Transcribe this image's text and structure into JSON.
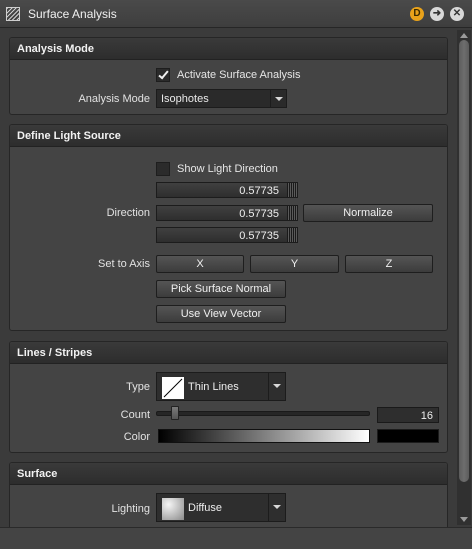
{
  "window": {
    "title": "Surface Analysis",
    "badge_label": "D"
  },
  "analysis_mode": {
    "header": "Analysis Mode",
    "activate_label": "Activate Surface Analysis",
    "activate_checked": true,
    "mode_label": "Analysis Mode",
    "mode_value": "Isophotes"
  },
  "light_source": {
    "header": "Define Light Source",
    "show_direction_label": "Show Light Direction",
    "show_direction_checked": false,
    "direction_label": "Direction",
    "direction_values": [
      "0.57735",
      "0.57735",
      "0.57735"
    ],
    "normalize_label": "Normalize",
    "set_axis_label": "Set to Axis",
    "axis_buttons": [
      "X",
      "Y",
      "Z"
    ],
    "pick_normal_label": "Pick Surface Normal",
    "view_vector_label": "Use View Vector"
  },
  "lines": {
    "header": "Lines / Stripes",
    "type_label": "Type",
    "type_value": "Thin Lines",
    "count_label": "Count",
    "count_value": "16",
    "count_slider_fraction": 0.07,
    "color_label": "Color",
    "color_value": "#000000"
  },
  "surface": {
    "header": "Surface",
    "lighting_label": "Lighting",
    "lighting_value": "Diffuse"
  },
  "colors": {
    "panel_bg": "#444444",
    "header_bg": "#2d2d2d",
    "accent_orange": "#e9a21a"
  }
}
